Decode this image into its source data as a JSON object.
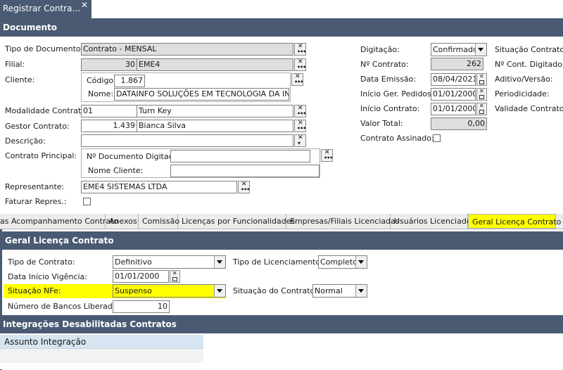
{
  "window_tab": {
    "title": "Registrar Contra…",
    "close": "✕"
  },
  "sections": {
    "documento": "Documento",
    "geral": "Geral Licença Contrato",
    "integracoes": "Integrações Desabilitadas Contratos"
  },
  "left": {
    "tipo_documento": {
      "label": "Tipo de Documento:",
      "value": "Contrato - MENSAL"
    },
    "filial": {
      "label": "Filial:",
      "code": "30",
      "name": "EME4"
    },
    "cliente": {
      "label": "Cliente:",
      "codigo_label": "Código:",
      "codigo": "1.867",
      "nome_label": "Nome:",
      "nome": "DATAINFO SOLUÇÕES EM TECNOLOGIA DA INFOR"
    },
    "modalidade": {
      "label": "Modalidade Contrato:",
      "code": "01",
      "name": "Turn Key"
    },
    "gestor": {
      "label": "Gestor Contrato:",
      "code": "1.439",
      "name": "Bianca Silva"
    },
    "descricao": {
      "label": "Descrição:",
      "value": ""
    },
    "contrato_principal": {
      "label": "Contrato Principal:",
      "doc_label": "Nº Documento Digitado:",
      "doc": "",
      "nome_label": "Nome Cliente:",
      "nome": ""
    },
    "representante": {
      "label": "Representante:",
      "value": "EME4 SISTEMAS LTDA"
    },
    "faturar": {
      "label": "Faturar Repres.:",
      "checked": false
    }
  },
  "right": {
    "digitacao": {
      "label": "Digitação:",
      "value": "Confirmado"
    },
    "n_contrato": {
      "label": "Nº Contrato:",
      "value": "262"
    },
    "data_emissao": {
      "label": "Data Emissão:",
      "value": "08/04/2021"
    },
    "inicio_ger": {
      "label": "Início Ger. Pedidos:",
      "value": "01/01/2000"
    },
    "inicio_contrato": {
      "label": "Início Contrato:",
      "value": "01/01/2000"
    },
    "valor_total": {
      "label": "Valor Total:",
      "value": "0,00"
    },
    "contrato_assinado": {
      "label": "Contrato Assinado:",
      "checked": false
    }
  },
  "far_right": [
    "Situação Contrato:",
    "Nº Cont. Digitado:",
    "Aditivo/Versão:",
    "Periodicidade:",
    "Validade Contrato:"
  ],
  "tabs": [
    "as Acompanhamento Contrato",
    "Anexos",
    "Comissão",
    "Licenças por Funcionalidades",
    "Empresas/Filiais Licenciadas",
    "Usuários Licenciados",
    "Geral Licença Contrato"
  ],
  "geral": {
    "tipo_contrato": {
      "label": "Tipo de Contrato:",
      "value": "Definitivo"
    },
    "tipo_licenciamento": {
      "label": "Tipo de Licenciamento:",
      "value": "Completo"
    },
    "data_inicio": {
      "label": "Data Início Vigência:",
      "value": "01/01/2000"
    },
    "situacao_nfe": {
      "label": "Situação NFe:",
      "value": "Suspenso"
    },
    "situacao_contrato": {
      "label": "Situação do Contrato:",
      "value": "Normal"
    },
    "bancos": {
      "label": "Número de Bancos Liberados:",
      "value": "10"
    }
  },
  "integracoes": {
    "column": "Assunto Integração"
  },
  "colors": {
    "header_bar": "#4a5a73",
    "highlight": "#ffff00",
    "readonly": "#dedede"
  }
}
